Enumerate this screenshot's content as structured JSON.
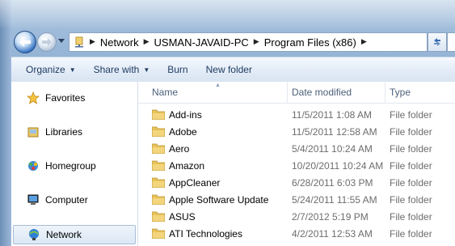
{
  "address": {
    "segments": [
      "Network",
      "USMAN-JAVAID-PC",
      "Program Files (x86)"
    ]
  },
  "toolbar": {
    "organize": "Organize",
    "share_with": "Share with",
    "burn": "Burn",
    "new_folder": "New folder"
  },
  "nav": {
    "favorites": "Favorites",
    "libraries": "Libraries",
    "homegroup": "Homegroup",
    "computer": "Computer",
    "network": "Network"
  },
  "columns": {
    "name": "Name",
    "date_modified": "Date modified",
    "type": "Type"
  },
  "rows": [
    {
      "name": "Add-ins",
      "date": "11/5/2011 1:08 AM",
      "type": "File folder"
    },
    {
      "name": "Adobe",
      "date": "11/5/2011 12:58 AM",
      "type": "File folder"
    },
    {
      "name": "Aero",
      "date": "5/4/2011 10:24 AM",
      "type": "File folder"
    },
    {
      "name": "Amazon",
      "date": "10/20/2011 10:24 AM",
      "type": "File folder"
    },
    {
      "name": "AppCleaner",
      "date": "6/28/2011 6:03 PM",
      "type": "File folder"
    },
    {
      "name": "Apple Software Update",
      "date": "5/24/2011 11:55 AM",
      "type": "File folder"
    },
    {
      "name": "ASUS",
      "date": "2/7/2012 5:19 PM",
      "type": "File folder"
    },
    {
      "name": "ATI Technologies",
      "date": "4/2/2011 12:53 AM",
      "type": "File folder"
    }
  ],
  "colors": {
    "folder": "#e8c35a",
    "selected_bg": "#dce8f5"
  }
}
